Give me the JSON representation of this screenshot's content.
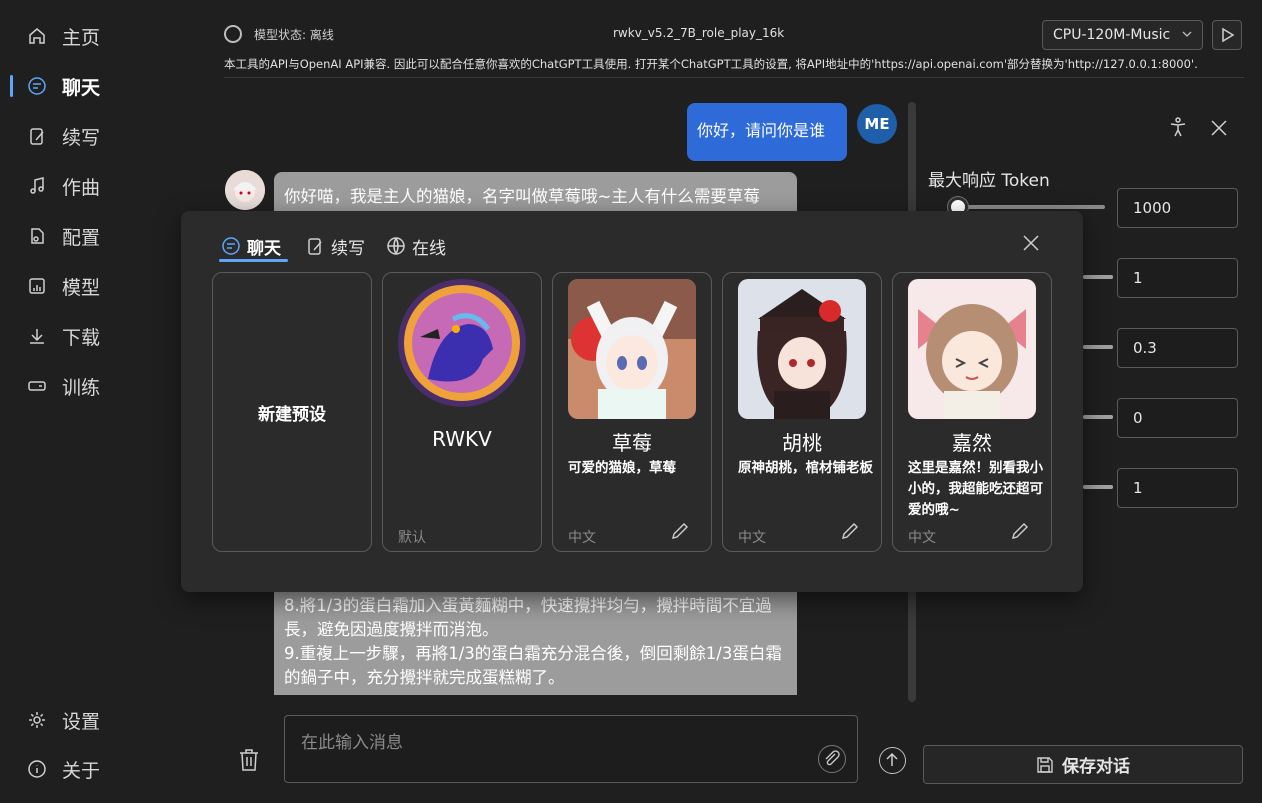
{
  "sidebar": {
    "items": [
      {
        "label": "主页",
        "icon": "home-icon"
      },
      {
        "label": "聊天",
        "icon": "chat-icon",
        "active": true
      },
      {
        "label": "续写",
        "icon": "write-icon"
      },
      {
        "label": "作曲",
        "icon": "music-icon"
      },
      {
        "label": "配置",
        "icon": "config-icon"
      },
      {
        "label": "模型",
        "icon": "model-icon"
      },
      {
        "label": "下载",
        "icon": "download-icon"
      },
      {
        "label": "训练",
        "icon": "train-icon"
      }
    ],
    "bottom": [
      {
        "label": "设置",
        "icon": "gear-icon"
      },
      {
        "label": "关于",
        "icon": "info-icon"
      }
    ]
  },
  "header": {
    "status": "模型状态: 离线",
    "model_name": "rwkv_v5.2_7B_role_play_16k",
    "strategy": "CPU-120M-Music",
    "api_note": "本工具的API与OpenAI API兼容. 因此可以配合任意你喜欢的ChatGPT工具使用. 打开某个ChatGPT工具的设置, 将API地址中的'https://api.openai.com'部分替换为'http://127.0.0.1:8000'."
  },
  "chat": {
    "user_message": "你好，请问你是谁",
    "user_avatar": "ME",
    "bot_message_top": "你好喵，我是主人的猫娘，名字叫做草莓哦~主人有什么需要草莓",
    "bot_message_bottom": "8.將1/3的蛋白霜加入蛋黃麵糊中，快速攪拌均勻，攪拌時間不宜過長，避免因過度攪拌而消泡。\n9.重複上一步驟，再將1/3的蛋白霜充分混合後，倒回剩餘1/3蛋白霜的鍋子中，充分攪拌就完成蛋糕糊了。"
  },
  "params": {
    "token_label": "最大响应 Token",
    "values": [
      "1000",
      "1",
      "0.3",
      "0",
      "1"
    ],
    "levels": [
      0.05,
      1.0,
      1.0,
      1.0,
      1.0
    ]
  },
  "composer": {
    "placeholder": "在此输入消息",
    "save_label": "保存对话"
  },
  "dialog": {
    "tabs": [
      {
        "label": "聊天",
        "icon": "chat-icon"
      },
      {
        "label": "续写",
        "icon": "write-icon"
      },
      {
        "label": "在线",
        "icon": "globe-icon"
      }
    ],
    "new_preset": "新建预设",
    "cards": [
      {
        "name": "RWKV",
        "desc": "",
        "lang": "默认",
        "editable": false
      },
      {
        "name": "草莓",
        "desc": "可爱的猫娘，草莓",
        "lang": "中文",
        "editable": true
      },
      {
        "name": "胡桃",
        "desc": "原神胡桃，棺材铺老板",
        "lang": "中文",
        "editable": true
      },
      {
        "name": "嘉然",
        "desc": "这里是嘉然！别看我小小的，我超能吃还超可爱的哦~",
        "lang": "中文",
        "editable": true
      }
    ]
  }
}
